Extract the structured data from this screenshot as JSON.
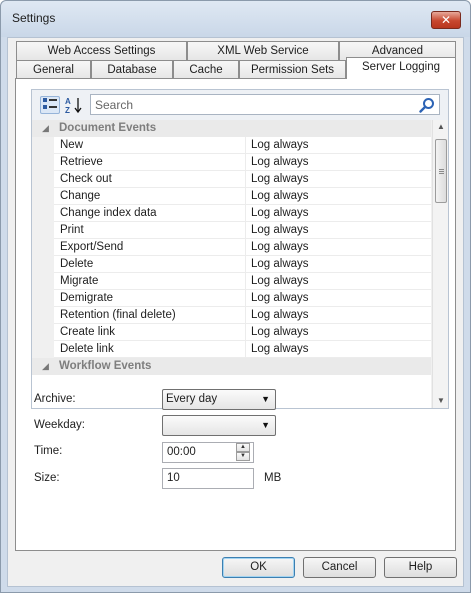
{
  "window": {
    "title": "Settings",
    "close_glyph": "✕"
  },
  "tabs_row1": [
    "Web Access Settings",
    "XML Web Service",
    "Advanced"
  ],
  "tabs_row2": [
    "General",
    "Database",
    "Cache",
    "Permission Sets",
    "Server Logging"
  ],
  "active_tab": "Server Logging",
  "grid": {
    "search_placeholder": "Search",
    "sort_icons": {
      "categorized": "categorized-view-icon",
      "alphabetical": "alphabetical-sort-icon"
    },
    "categories": [
      {
        "label": "Document Events",
        "properties": [
          {
            "name": "New",
            "value": "Log always"
          },
          {
            "name": "Retrieve",
            "value": "Log always"
          },
          {
            "name": "Check out",
            "value": "Log always"
          },
          {
            "name": "Change",
            "value": "Log always"
          },
          {
            "name": "Change index data",
            "value": "Log always"
          },
          {
            "name": "Print",
            "value": "Log always"
          },
          {
            "name": "Export/Send",
            "value": "Log always"
          },
          {
            "name": "Delete",
            "value": "Log always"
          },
          {
            "name": "Migrate",
            "value": "Log always"
          },
          {
            "name": "Demigrate",
            "value": "Log always"
          },
          {
            "name": "Retention (final delete)",
            "value": "Log always"
          },
          {
            "name": "Create link",
            "value": "Log always"
          },
          {
            "name": "Delete link",
            "value": "Log always"
          }
        ]
      },
      {
        "label": "Workflow Events",
        "properties": []
      }
    ]
  },
  "form": {
    "archive": {
      "label": "Archive:",
      "value": "Every day"
    },
    "weekday": {
      "label": "Weekday:",
      "value": ""
    },
    "time": {
      "label": "Time:",
      "value": "00:00"
    },
    "size": {
      "label": "Size:",
      "value": "10",
      "unit": "MB"
    }
  },
  "buttons": {
    "ok": "OK",
    "cancel": "Cancel",
    "help": "Help"
  }
}
